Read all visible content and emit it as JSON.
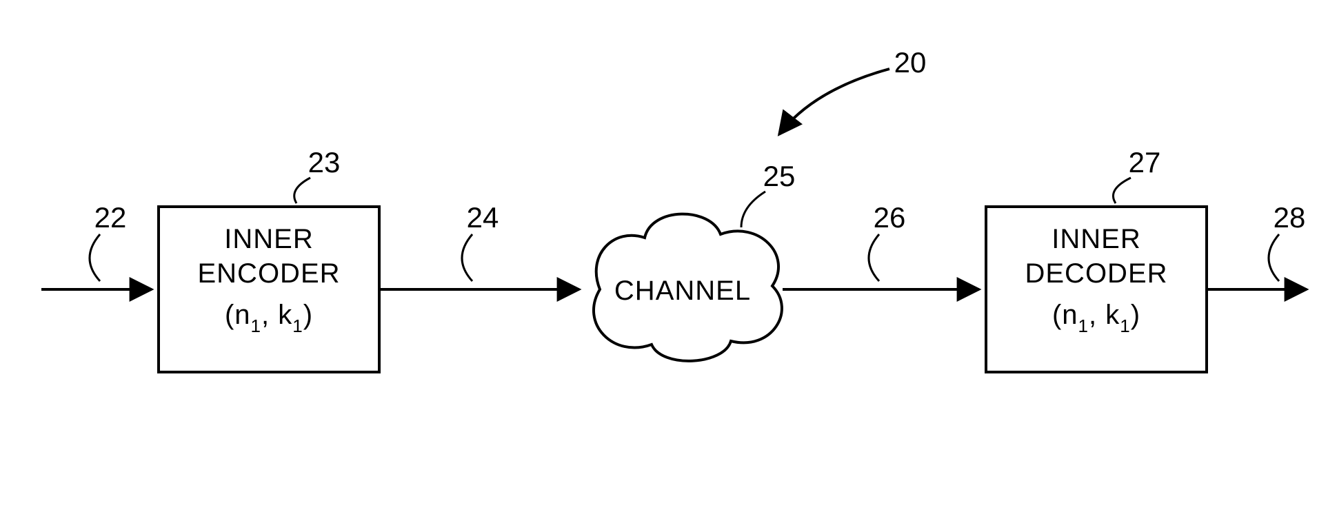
{
  "diagram": {
    "main_ref": "20",
    "input_ref": "22",
    "encoder_ref": "23",
    "encoder_line1": "INNER",
    "encoder_line2": "ENCODER",
    "encoder_n_sym": "n",
    "encoder_n_sub": "1",
    "encoder_k_sym": "k",
    "encoder_k_sub": "1",
    "encoder_open": "(",
    "encoder_comma": ", ",
    "encoder_close": ")",
    "enc_to_ch_ref": "24",
    "channel_ref": "25",
    "channel_label": "CHANNEL",
    "ch_to_dec_ref": "26",
    "decoder_ref": "27",
    "decoder_line1": "INNER",
    "decoder_line2": "DECODER",
    "decoder_n_sym": "n",
    "decoder_n_sub": "1",
    "decoder_k_sym": "k",
    "decoder_k_sub": "1",
    "decoder_open": "(",
    "decoder_comma": ", ",
    "decoder_close": ")",
    "output_ref": "28"
  }
}
